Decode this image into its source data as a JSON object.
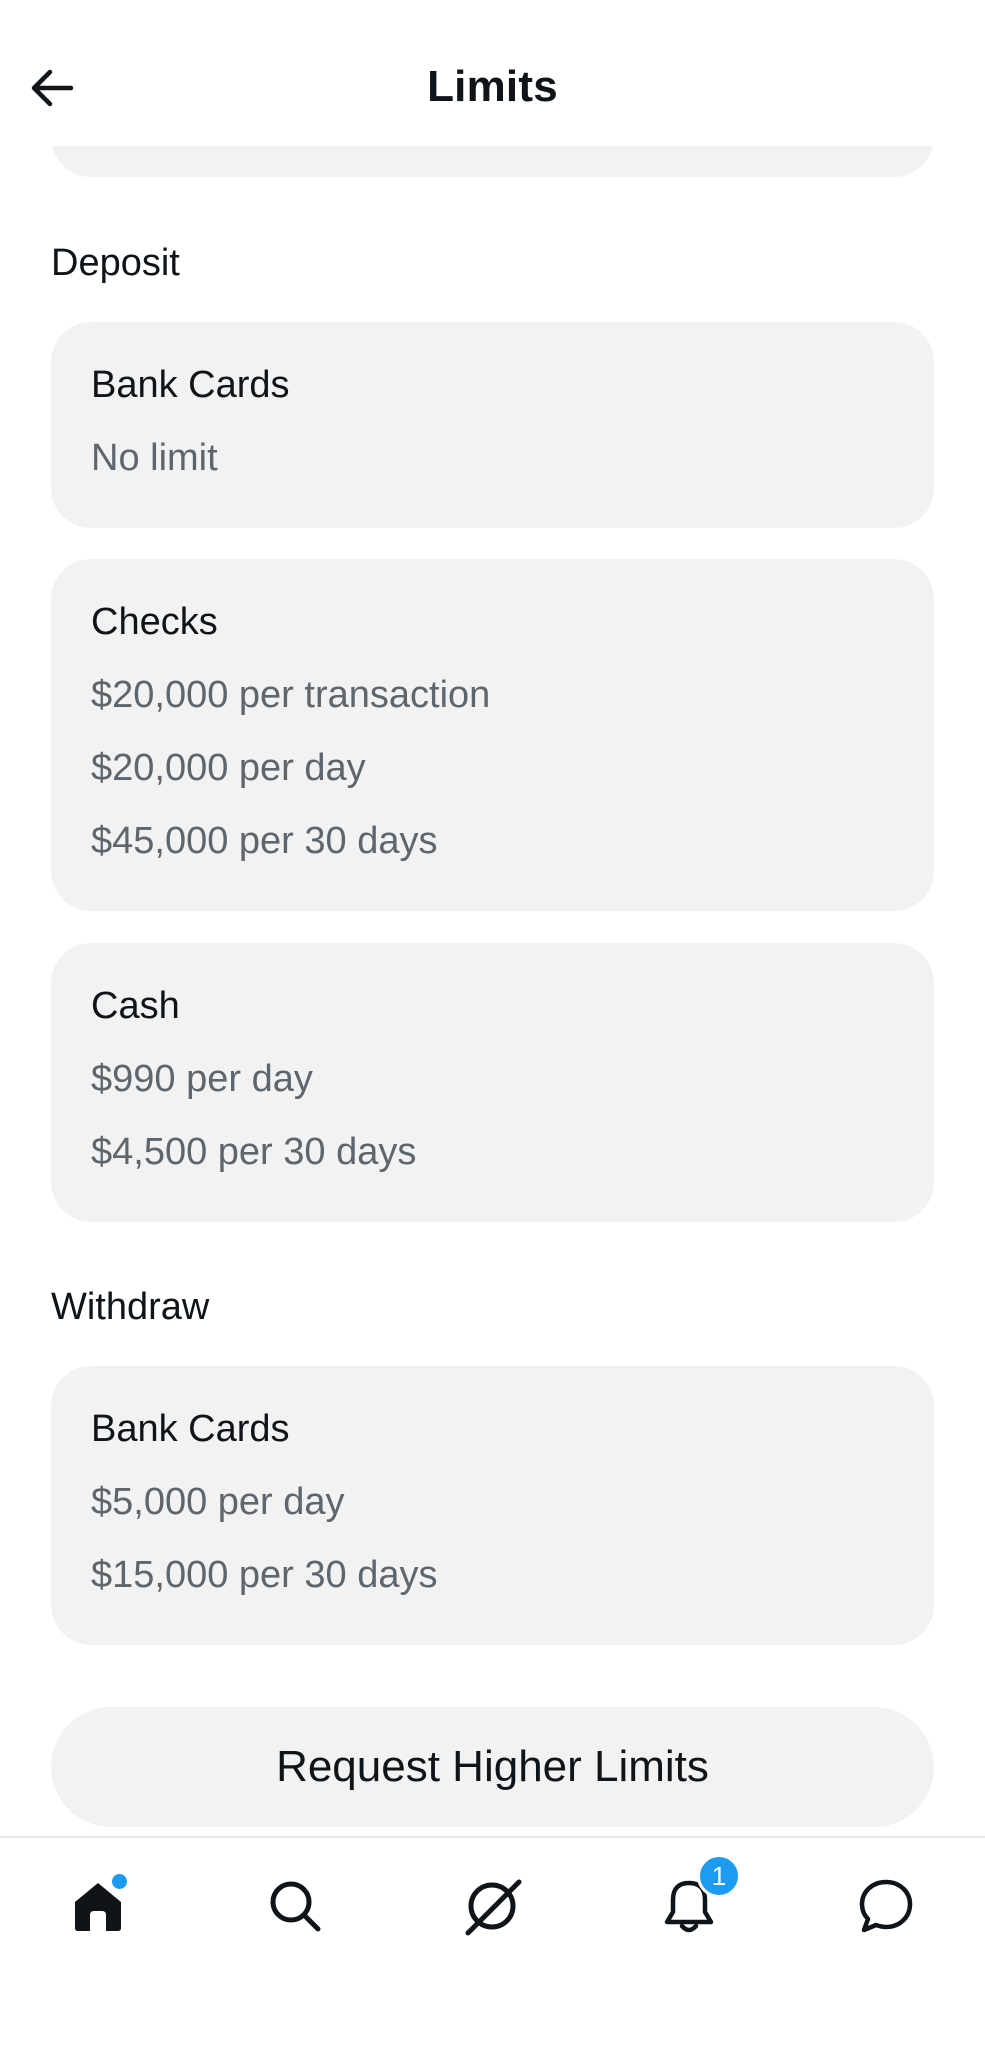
{
  "header": {
    "title": "Limits"
  },
  "deposit": {
    "section_title": "Deposit",
    "cards": [
      {
        "title": "Bank Cards",
        "lines": [
          "No limit"
        ]
      },
      {
        "title": "Checks",
        "lines": [
          "$20,000 per transaction",
          "$20,000 per day",
          "$45,000 per 30 days"
        ]
      },
      {
        "title": "Cash",
        "lines": [
          "$990 per day",
          "$4,500 per 30 days"
        ]
      }
    ]
  },
  "withdraw": {
    "section_title": "Withdraw",
    "cards": [
      {
        "title": "Bank Cards",
        "lines": [
          "$5,000 per day",
          "$15,000 per 30 days"
        ]
      }
    ]
  },
  "request_button": {
    "label": "Request Higher Limits"
  },
  "tabbar": {
    "items": [
      {
        "name": "home",
        "icon": "home-icon",
        "has_dot": true
      },
      {
        "name": "search",
        "icon": "search-icon"
      },
      {
        "name": "grok",
        "icon": "grok-icon"
      },
      {
        "name": "notifications",
        "icon": "bell-icon",
        "badge": "1"
      },
      {
        "name": "messages",
        "icon": "message-icon"
      }
    ]
  },
  "colors": {
    "accent": "#1d9bf0",
    "card_bg": "#f2f2f2",
    "secondary_text": "#5e666d"
  }
}
